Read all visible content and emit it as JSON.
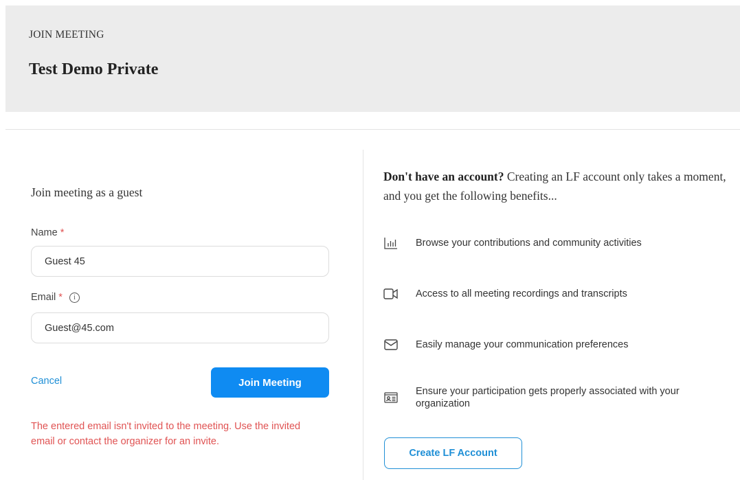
{
  "header": {
    "kicker": "JOIN MEETING",
    "title": "Test Demo Private"
  },
  "guest_form": {
    "heading": "Join meeting as a guest",
    "name_label": "Name",
    "name_value": "Guest 45",
    "email_label": "Email",
    "email_value": "Guest@45.com",
    "required_marker": "*",
    "cancel_label": "Cancel",
    "join_label": "Join Meeting",
    "error_message": "The entered email isn't invited to the meeting. Use the invited email or contact the organizer for an invite."
  },
  "benefits": {
    "intro_bold": "Don't have an account?",
    "intro_rest": " Creating an LF account only takes a moment, and you get the following benefits...",
    "items": [
      {
        "icon": "bar-chart-icon",
        "text": "Browse your contributions and community activities"
      },
      {
        "icon": "video-camera-icon",
        "text": "Access to all meeting recordings and transcripts"
      },
      {
        "icon": "envelope-icon",
        "text": "Easily manage your communication preferences"
      },
      {
        "icon": "id-card-icon",
        "text": "Ensure your participation gets properly associated with your organization"
      }
    ],
    "create_label": "Create LF Account"
  },
  "colors": {
    "primary": "#0f8bf2",
    "link": "#1f8fd6",
    "error": "#e05353",
    "header_bg": "#ececec"
  }
}
